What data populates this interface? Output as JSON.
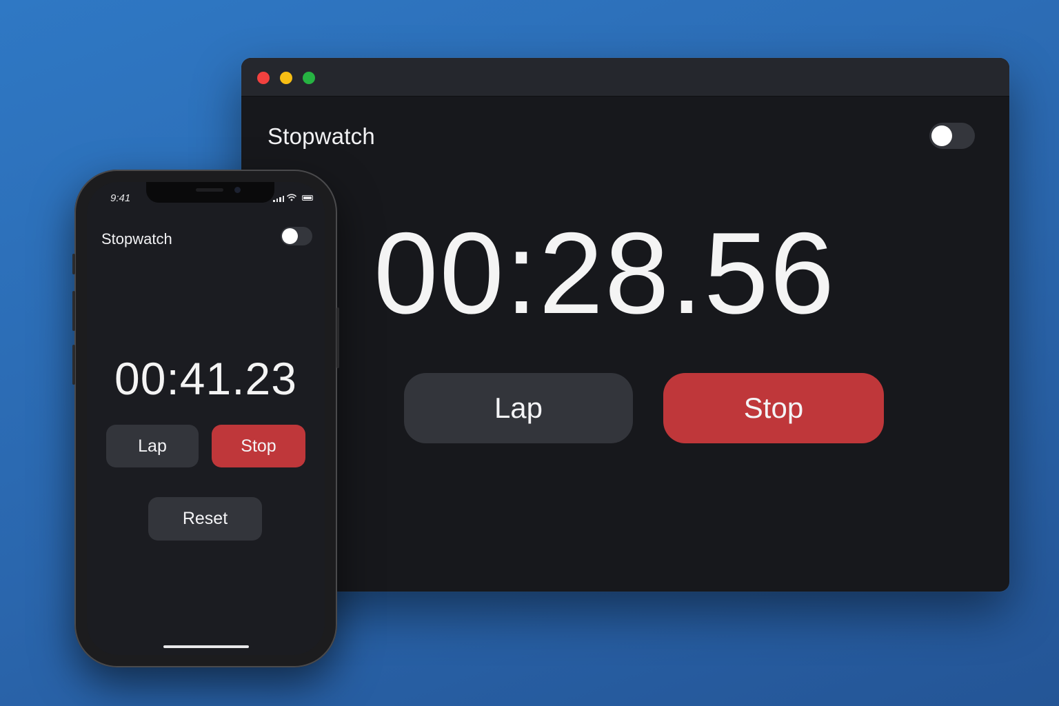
{
  "desktop": {
    "title": "Stopwatch",
    "time": "00:28.56",
    "lap_label": "Lap",
    "stop_label": "Stop",
    "toggle_on": false
  },
  "phone": {
    "status_time": "9:41",
    "title": "Stopwatch",
    "time": "00:41.23",
    "lap_label": "Lap",
    "stop_label": "Stop",
    "reset_label": "Reset",
    "toggle_on": false
  },
  "colors": {
    "background": "#2c6bb6",
    "window": "#17181c",
    "titlebar": "#25272d",
    "button_grey": "#33353b",
    "button_red": "#bf373a",
    "traffic_close": "#f2413f",
    "traffic_minimize": "#f7be14",
    "traffic_maximize": "#26b342"
  },
  "icons": {
    "close": "window-close-icon",
    "minimize": "window-minimize-icon",
    "maximize": "window-maximize-icon",
    "signal": "cellular-signal-icon",
    "wifi": "wifi-icon",
    "battery": "battery-icon"
  }
}
